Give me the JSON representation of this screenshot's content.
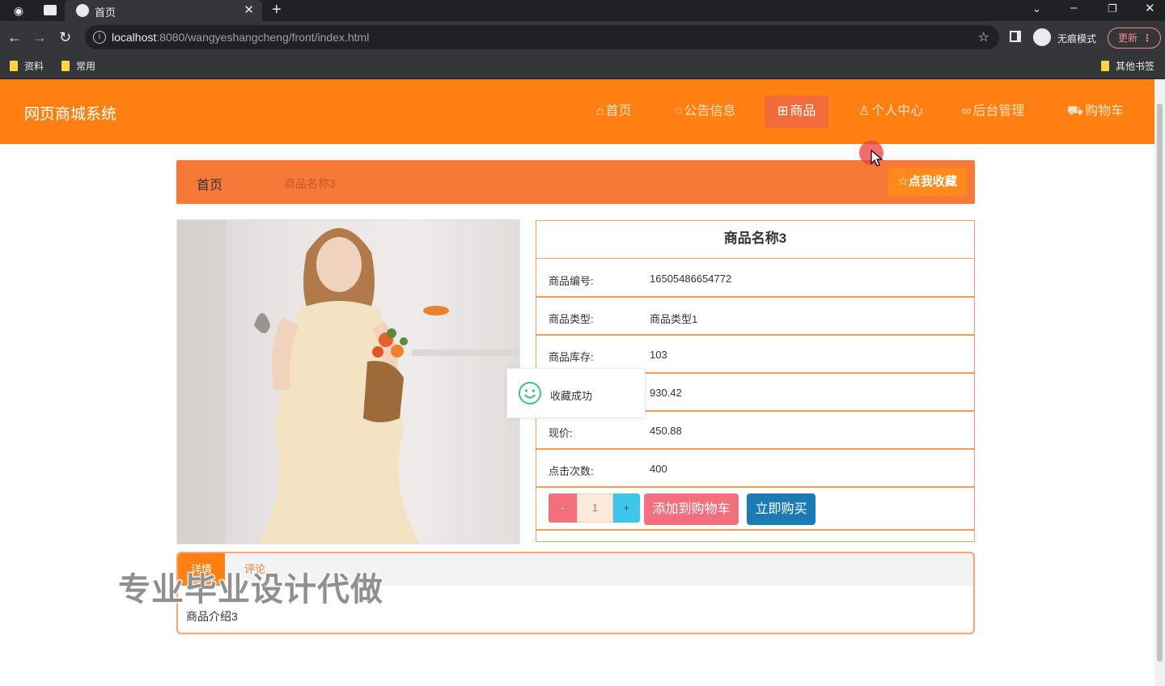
{
  "browser": {
    "tab_title": "首页",
    "url_host": "localhost",
    "url_rest": ":8080/wangyeshangcheng/front/index.html",
    "incognito_label": "无痕模式",
    "update_label": "更新",
    "bookmarks": [
      "资料",
      "常用"
    ],
    "other_bookmarks": "其他书签"
  },
  "site": {
    "title": "网页商城系统",
    "nav": [
      {
        "label": "首页",
        "icon": "home-icon",
        "glyph": "⌂"
      },
      {
        "label": "公告信息",
        "icon": "notice-icon",
        "glyph": "◌"
      },
      {
        "label": "商品",
        "icon": "goods-icon",
        "glyph": "⊞"
      },
      {
        "label": "个人中心",
        "icon": "user-icon",
        "glyph": "♙"
      },
      {
        "label": "后台管理",
        "icon": "link-icon",
        "glyph": "∞"
      },
      {
        "label": "购物车",
        "icon": "cart-icon",
        "glyph": "⛟"
      }
    ],
    "active_nav": "商品"
  },
  "breadcrumb": {
    "home": "首页",
    "current": "商品名称3",
    "favorite_label": "点我收藏",
    "favorite_glyph": "☆"
  },
  "product": {
    "name": "商品名称3",
    "rows": [
      {
        "key": "商品编号:",
        "value": "16505486654772"
      },
      {
        "key": "商品类型:",
        "value": "商品类型1"
      },
      {
        "key": "商品库存:",
        "value": "103"
      },
      {
        "key": "",
        "value": "930.42"
      },
      {
        "key": "现价:",
        "value": "450.88"
      },
      {
        "key": "点击次数:",
        "value": "400"
      }
    ],
    "quantity": "1",
    "minus": "-",
    "plus": "+",
    "add_to_cart": "添加到购物车",
    "buy_now": "立即购买"
  },
  "toast": {
    "message": "收藏成功"
  },
  "detail": {
    "tabs": [
      "详情",
      "评论"
    ],
    "body": "商品介绍3"
  },
  "watermark": "专业毕业设计代做",
  "colors": {
    "header": "#ff8010",
    "breadcrumb": "#f57a38",
    "cart_button": "#f2707e",
    "buy_button": "#1c7bb5",
    "plus_button": "#3dc6ea"
  }
}
